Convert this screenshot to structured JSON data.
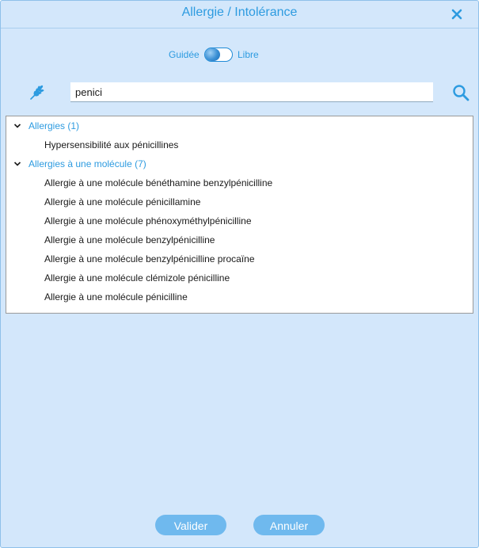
{
  "dialog": {
    "title": "Allergie / Intolérance",
    "mode": {
      "left_label": "Guidée",
      "right_label": "Libre",
      "selected": "Guidée"
    },
    "search": {
      "value": "penici",
      "placeholder": ""
    },
    "groups": [
      {
        "label": "Allergies (1)",
        "expanded": true,
        "items": [
          "Hypersensibilité aux pénicillines"
        ]
      },
      {
        "label": "Allergies à une molécule (7)",
        "expanded": true,
        "items": [
          "Allergie à une molécule bénéthamine benzylpénicilline",
          "Allergie à une molécule pénicillamine",
          "Allergie à une molécule phénoxyméthylpénicilline",
          "Allergie à une molécule benzylpénicilline",
          "Allergie à une molécule benzylpénicilline procaïne",
          "Allergie à une molécule clémizole pénicilline",
          "Allergie à une molécule pénicilline"
        ]
      }
    ],
    "buttons": {
      "ok": "Valider",
      "cancel": "Annuler"
    },
    "icons": {
      "close": "close-icon",
      "category": "wheat-icon",
      "search": "search-icon",
      "expand": "chevron-down-icon"
    },
    "colors": {
      "accent": "#2d9be0",
      "background": "#d3e7fb",
      "button": "#6fb9ee"
    }
  }
}
